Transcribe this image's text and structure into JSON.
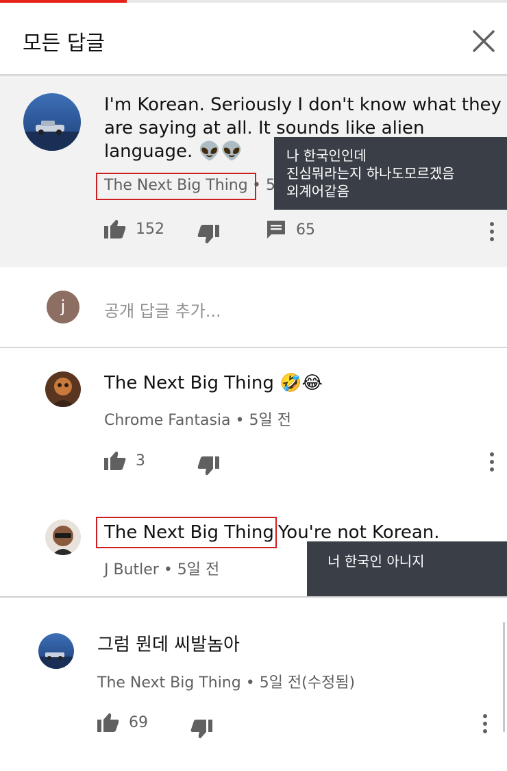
{
  "header": {
    "title": "모든 답글",
    "close_icon": "close-icon",
    "progress_fraction": 0.25,
    "progress_color": "#e62117"
  },
  "top_comment": {
    "text_line1": "I'm Korean. Seriously I don't know what they",
    "text_line2": "are saying at all.  It sounds like alien",
    "text_line3": "language.",
    "emoji": "👽👽",
    "author": "The Next Big Thing",
    "time_partial": "• 5",
    "likes": "152",
    "replies": "65",
    "translation": [
      "나 한국인인데",
      "진심뭐라는지 하나도모르겠음",
      "외계어같음"
    ]
  },
  "reply_box": {
    "avatar_letter": "j",
    "placeholder": "공개 답글 추가..."
  },
  "replies": [
    {
      "text": "The Next Big Thing",
      "emoji": "🤣😂",
      "author": "Chrome Fantasia",
      "time": " • 5일 전",
      "likes": "3"
    },
    {
      "mention": "The Next Big Thing",
      "text": "You're not Korean.",
      "author": "J Butler",
      "time": " • 5일 전",
      "translation": "너 한국인 아니지"
    },
    {
      "text": "그럼 뭔데 씨발놈아",
      "author": "The Next Big Thing",
      "time": " • 5일 전(수정됨)",
      "likes": "69"
    }
  ],
  "colors": {
    "highlight": "#cc1f1f",
    "overlay": "#3a3f47",
    "meta": "#606060"
  }
}
